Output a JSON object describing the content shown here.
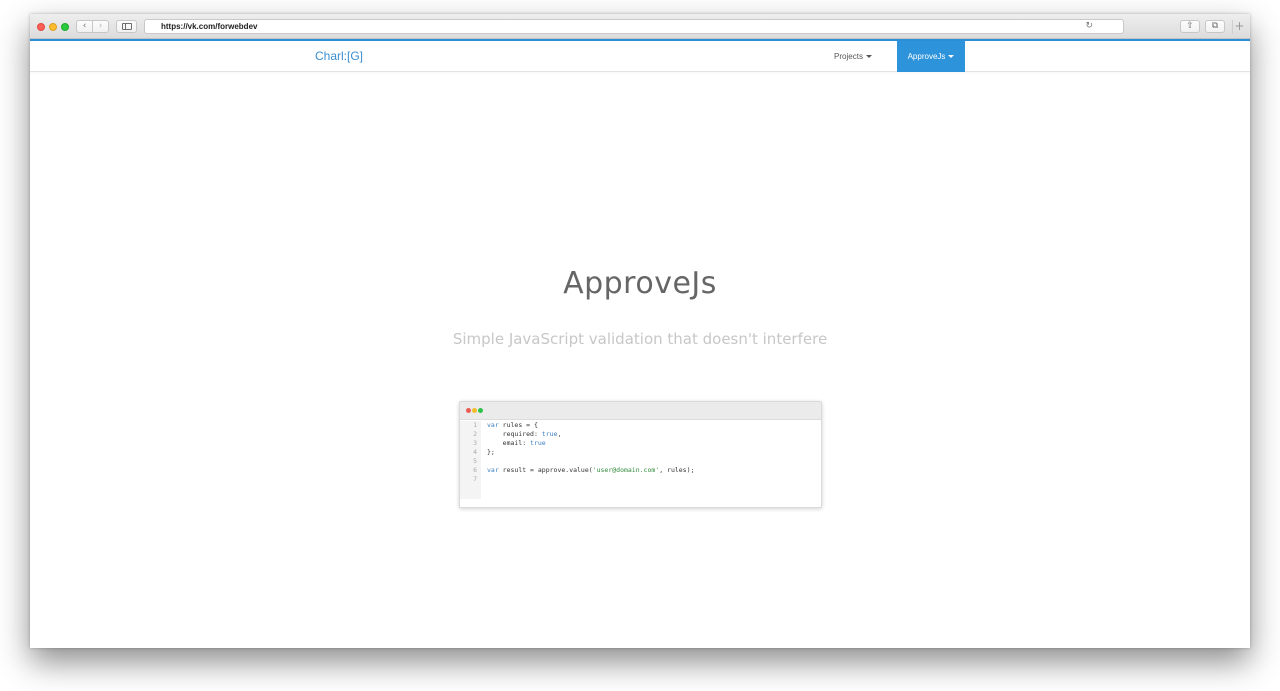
{
  "browser": {
    "url": "https://vk.com/forwebdev",
    "back_icon": "chevron-left-icon",
    "forward_icon": "chevron-right-icon",
    "reload_icon": "reload-icon",
    "new_tab": "+"
  },
  "navbar": {
    "brand": "Charl:[G]",
    "items": [
      {
        "label": "Projects",
        "active": false
      },
      {
        "label": "ApproveJs",
        "active": true
      }
    ],
    "accent": "#2d93da"
  },
  "hero": {
    "title": "ApproveJs",
    "subtitle": "Simple JavaScript validation that doesn't interfere"
  },
  "code_sample": {
    "lines": [
      {
        "n": "1",
        "text": "var rules = {"
      },
      {
        "n": "2",
        "text": "    required: true,"
      },
      {
        "n": "3",
        "text": "    email: true"
      },
      {
        "n": "4",
        "text": "};"
      },
      {
        "n": "5",
        "text": ""
      },
      {
        "n": "6",
        "text": "var result = approve.value('user@domain.com', rules);"
      },
      {
        "n": "7",
        "text": ""
      }
    ]
  }
}
